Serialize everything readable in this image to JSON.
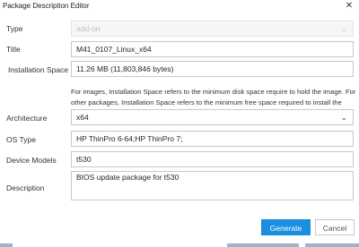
{
  "window": {
    "title": "Package Description Editor",
    "close_glyph": "✕"
  },
  "form": {
    "type": {
      "label": "Type",
      "value": "add-on"
    },
    "title": {
      "label": "Title",
      "value": "M41_0107_Linux_x64"
    },
    "installation_space": {
      "label": "Installation Space",
      "info_glyph": "i",
      "value": "11.26 MB (11,803,846 bytes)",
      "help": "For images, Installation Space refers to the minimum disk space require to hold the image. For other packages, Installation Space refers to the minimum free space required to install the package."
    },
    "architecture": {
      "label": "Architecture",
      "value": "x64"
    },
    "os_type": {
      "label": "OS Type",
      "value": "HP ThinPro 6-64;HP ThinPro 7;"
    },
    "device_models": {
      "label": "Device Models",
      "value": "t530"
    },
    "description": {
      "label": "Description",
      "value": "BIOS update package for t530"
    }
  },
  "buttons": {
    "generate": "Generate",
    "cancel": "Cancel"
  },
  "icons": {
    "dropdown": "chevron-down-icon",
    "info": "info-icon",
    "close": "close-icon"
  },
  "colors": {
    "accent": "#1a8fe0",
    "info": "#0096d6"
  }
}
